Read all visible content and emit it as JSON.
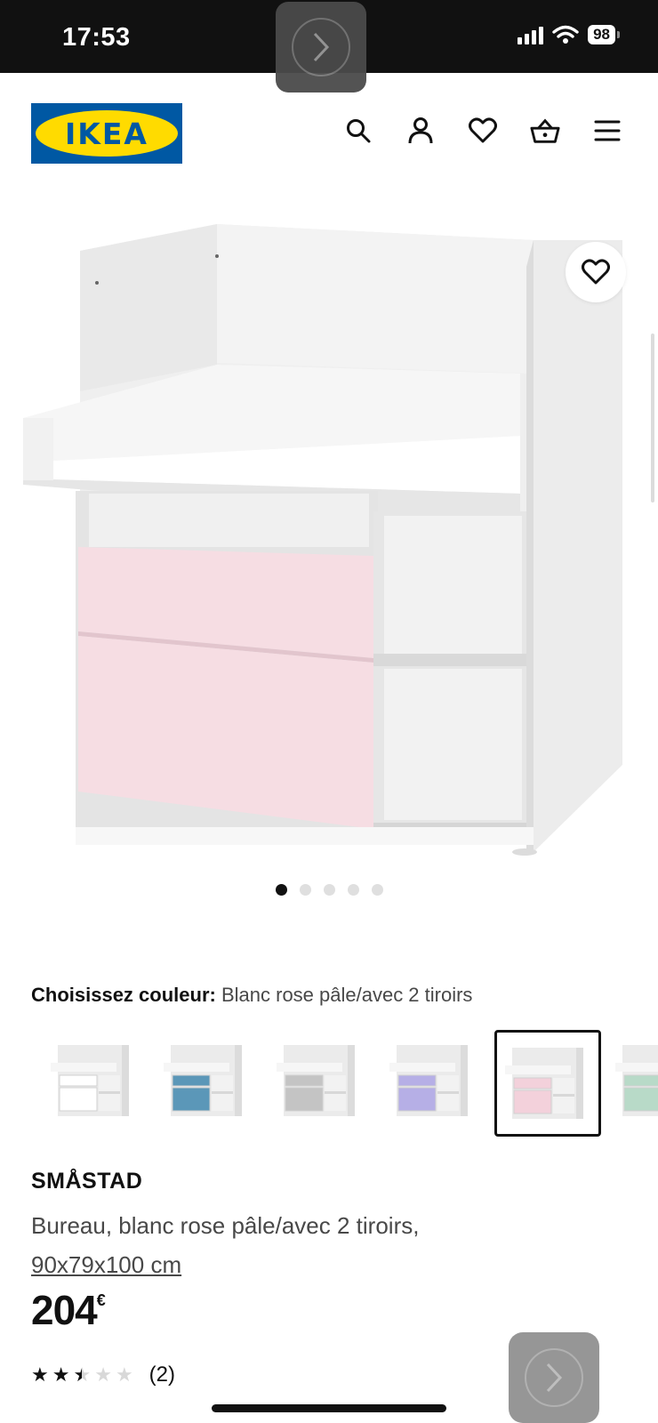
{
  "status_bar": {
    "time": "17:53",
    "battery": "98"
  },
  "brand": {
    "logo_text": "IKEA",
    "blue": "#0058a3",
    "yellow": "#ffdb00"
  },
  "header": {
    "icons": [
      "search-icon",
      "account-icon",
      "heart-icon",
      "basket-icon",
      "menu-icon"
    ]
  },
  "gallery": {
    "favorite_icon": "heart-icon",
    "dot_count": 5,
    "active_dot": 1
  },
  "color_chooser": {
    "label": "Choisissez couleur:",
    "value": "Blanc rose pâle/avec 2 tiroirs",
    "swatch_colors": [
      "#ffffff",
      "#5b97b8",
      "#c4c4c4",
      "#b6afe6",
      "#f3d1db",
      "#b8dac8"
    ],
    "selected_index": 4
  },
  "product": {
    "name": "SMÅSTAD",
    "description": "Bureau, blanc rose pâle/avec 2 tiroirs,",
    "size": "90x79x100 cm",
    "price": "204",
    "currency": "€",
    "rating": 2.5,
    "rating_max": 5,
    "review_count": "(2)"
  }
}
